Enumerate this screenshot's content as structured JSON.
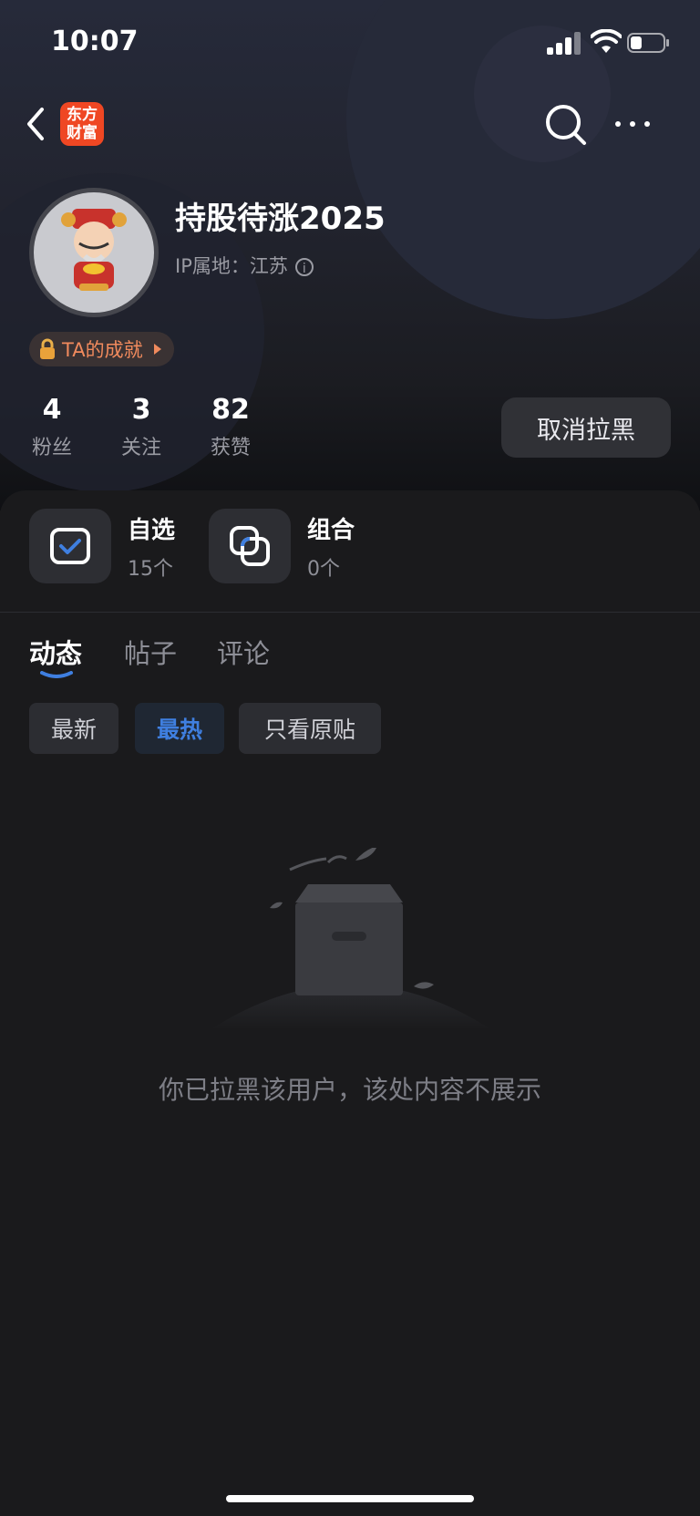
{
  "status_bar": {
    "time": "10:07",
    "battery_level": 0.35
  },
  "nav": {
    "logo_line1": "东方",
    "logo_line2": "财富",
    "brand_color": "#ef4723"
  },
  "profile": {
    "username": "持股待涨2025",
    "ip_label": "IP属地：江苏",
    "achievement": "TA的成就",
    "stats": [
      {
        "value": "4",
        "label": "粉丝"
      },
      {
        "value": "3",
        "label": "关注"
      },
      {
        "value": "82",
        "label": "获赞"
      }
    ],
    "unblock_label": "取消拉黑"
  },
  "cards": [
    {
      "title": "自选",
      "count": "15个",
      "icon": "checkbox-icon"
    },
    {
      "title": "组合",
      "count": "0个",
      "icon": "portfolio-icon"
    }
  ],
  "tabs": [
    {
      "label": "动态",
      "active": true
    },
    {
      "label": "帖子",
      "active": false
    },
    {
      "label": "评论",
      "active": false
    }
  ],
  "filters": [
    {
      "label": "最新",
      "active": false
    },
    {
      "label": "最热",
      "active": true
    },
    {
      "label": "只看原贴",
      "active": false
    }
  ],
  "empty_state": {
    "message": "你已拉黑该用户，该处内容不展示"
  },
  "colors": {
    "accent": "#3f7fe0",
    "achievement": "#f08a5d",
    "background": "#19191b"
  }
}
